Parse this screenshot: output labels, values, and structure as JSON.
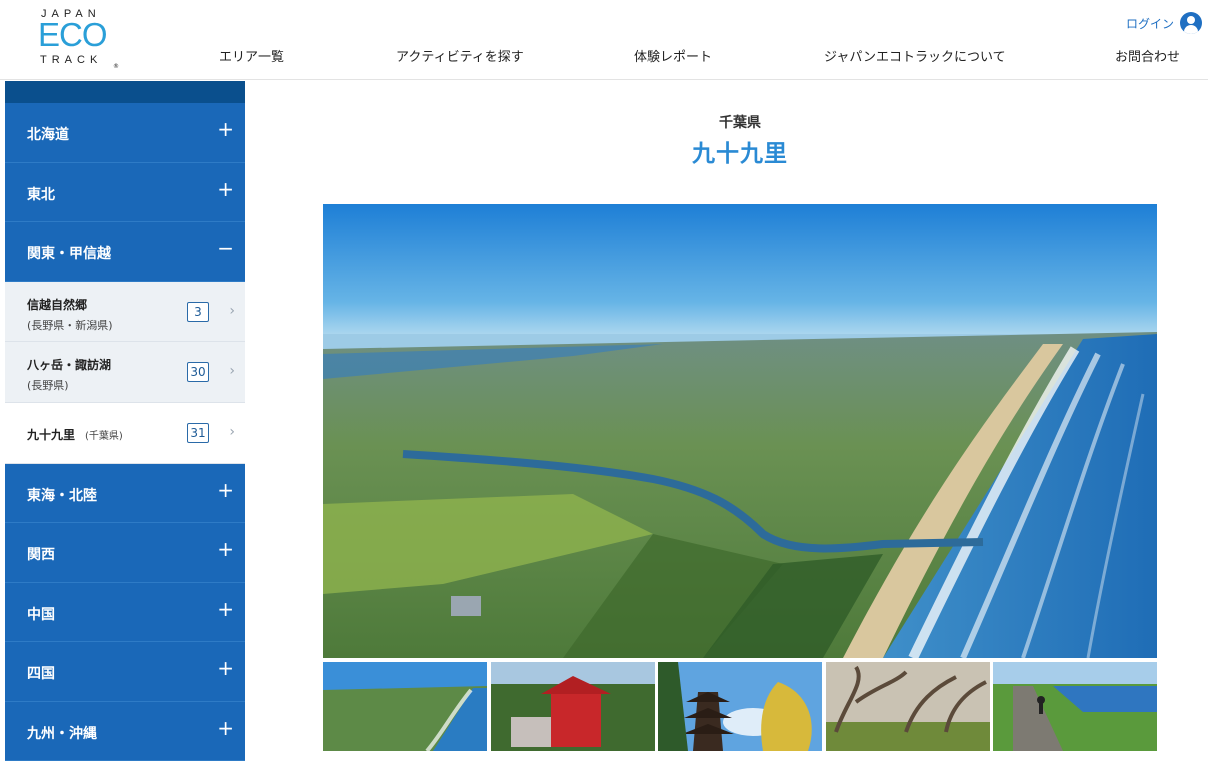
{
  "header": {
    "logo": {
      "line1": "JAPAN",
      "line2": "ECO",
      "line3": "TRACK",
      "reg": "®"
    },
    "nav": [
      {
        "label": "エリア一覧"
      },
      {
        "label": "アクティビティを探す"
      },
      {
        "label": "体験レポート"
      },
      {
        "label": "ジャパンエコトラックについて"
      },
      {
        "label": "お問合わせ"
      }
    ],
    "login_label": "ログイン"
  },
  "sidebar": {
    "regions": [
      {
        "name": "北海道",
        "toggle": "+"
      },
      {
        "name": "東北",
        "toggle": "+"
      },
      {
        "name": "関東・甲信越",
        "toggle": "−"
      },
      {
        "name": "東海・北陸",
        "toggle": "+"
      },
      {
        "name": "関西",
        "toggle": "+"
      },
      {
        "name": "中国",
        "toggle": "+"
      },
      {
        "name": "四国",
        "toggle": "+"
      },
      {
        "name": "九州・沖縄",
        "toggle": "+"
      }
    ],
    "subitems": [
      {
        "name": "信越自然郷",
        "pref": "(長野県・新潟県)",
        "count": "3"
      },
      {
        "name": "八ヶ岳・諏訪湖",
        "pref": "(長野県)",
        "count": "30"
      },
      {
        "name": "九十九里",
        "pref": "(千葉県)",
        "count": "31"
      }
    ],
    "chevron": "›"
  },
  "main": {
    "prefecture": "千葉県",
    "area_title": "九十九里"
  },
  "colors": {
    "accent": "#1a68b8",
    "title_blue": "#2a8ad4",
    "sidebar_dark": "#0a4f8d"
  }
}
